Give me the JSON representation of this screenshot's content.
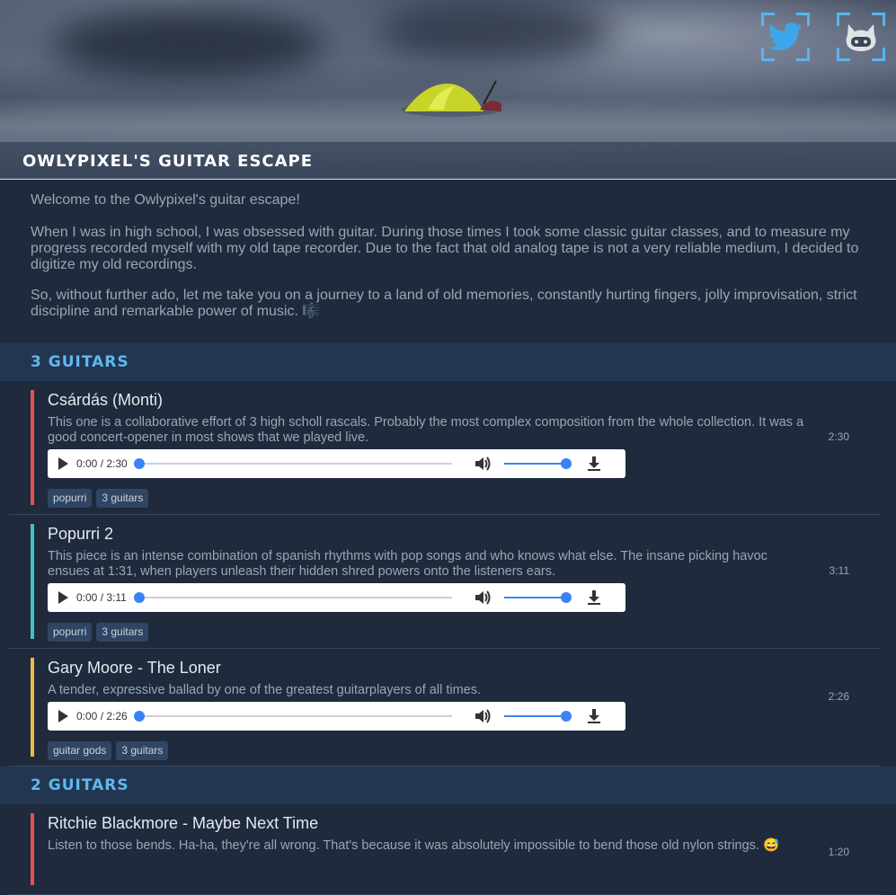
{
  "header": {
    "title": "OWLYPIXEL'S GUITAR ESCAPE",
    "twitter_icon": "twitter-icon",
    "github_icon": "github-icon",
    "accent": "#59b4f0"
  },
  "intro": {
    "p1": "Welcome to the Owlypixel's guitar escape!",
    "p2": "When I was in high school, I was obsessed with guitar. During those times I took some classic guitar classes, and to measure my progress recorded myself with my old tape recorder. Due to the fact that old analog tape is not a very reliable medium, I decided to digitize my old recordings.",
    "p3": "So, without further ado, let me take you on a journey to a land of old memories, constantly hurting fingers, jolly improvisation, strict discipline and remarkable power of music.",
    "p3_emoji": "🎼"
  },
  "sections": [
    {
      "title": "3 GUITARS",
      "tracks": [
        {
          "title": "Csárdás (Monti)",
          "description": "This one is a collaborative effort of 3 high scholl rascals. Probably the most complex composition from the whole collection. It was a good concert-opener in most shows that we played live.",
          "duration": "2:30",
          "time": "0:00 / 2:30",
          "tags": [
            "popurri",
            "3 guitars"
          ],
          "color": "#e05252"
        },
        {
          "title": "Popurri 2",
          "description": "This piece is an intense combination of spanish rhythms with pop songs and who knows what else. The insane picking havoc ensues at 1:31, when players unleash their hidden shred powers onto the listeners ears.",
          "duration": "3:11",
          "time": "0:00 / 3:11",
          "tags": [
            "popurri",
            "3 guitars"
          ],
          "color": "#3fc1c9"
        },
        {
          "title": "Gary Moore - The Loner",
          "description": "A tender, expressive ballad by one of the greatest guitarplayers of all times.",
          "duration": "2:26",
          "time": "0:00 / 2:26",
          "tags": [
            "guitar gods",
            "3 guitars"
          ],
          "color": "#f2b84b"
        }
      ]
    },
    {
      "title": "2 GUITARS",
      "tracks": [
        {
          "title": "Ritchie Blackmore - Maybe Next Time",
          "description": "Listen to those bends. Ha-ha, they're all wrong. That's because it was absolutely impossible to bend those old nylon strings.",
          "description_emoji": "😅",
          "duration": "1:20",
          "color": "#e05252"
        }
      ]
    }
  ]
}
